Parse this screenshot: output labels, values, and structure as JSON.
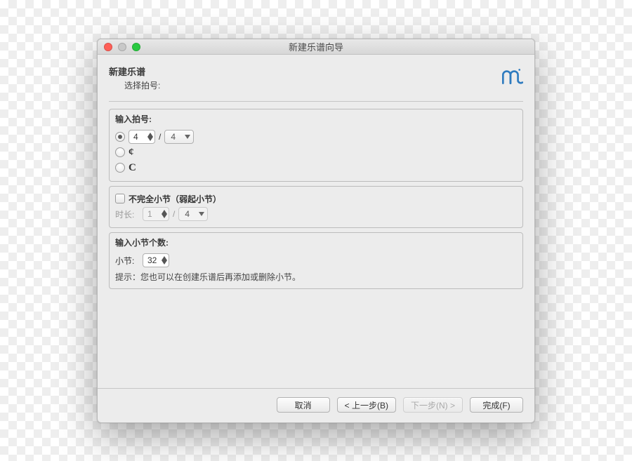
{
  "window": {
    "title": "新建乐谱向导"
  },
  "header": {
    "title": "新建乐谱",
    "subtitle": "选择拍号:"
  },
  "timesig": {
    "group_label": "输入拍号:",
    "numerator": "4",
    "slash": "/",
    "denominator": "4",
    "cut_symbol": "¢",
    "common_symbol": "C"
  },
  "pickup": {
    "checkbox_label": "不完全小节（弱起小节）",
    "duration_label": "时长:",
    "numerator": "1",
    "slash": "/",
    "denominator": "4"
  },
  "measures": {
    "group_label": "输入小节个数:",
    "count_label": "小节:",
    "count": "32",
    "hint_label": "提示：",
    "hint_text": "您也可以在创建乐谱后再添加或删除小节。"
  },
  "footer": {
    "cancel": "取消",
    "back": "< 上一步(B)",
    "next": "下一步(N) >",
    "finish": "完成(F)"
  }
}
